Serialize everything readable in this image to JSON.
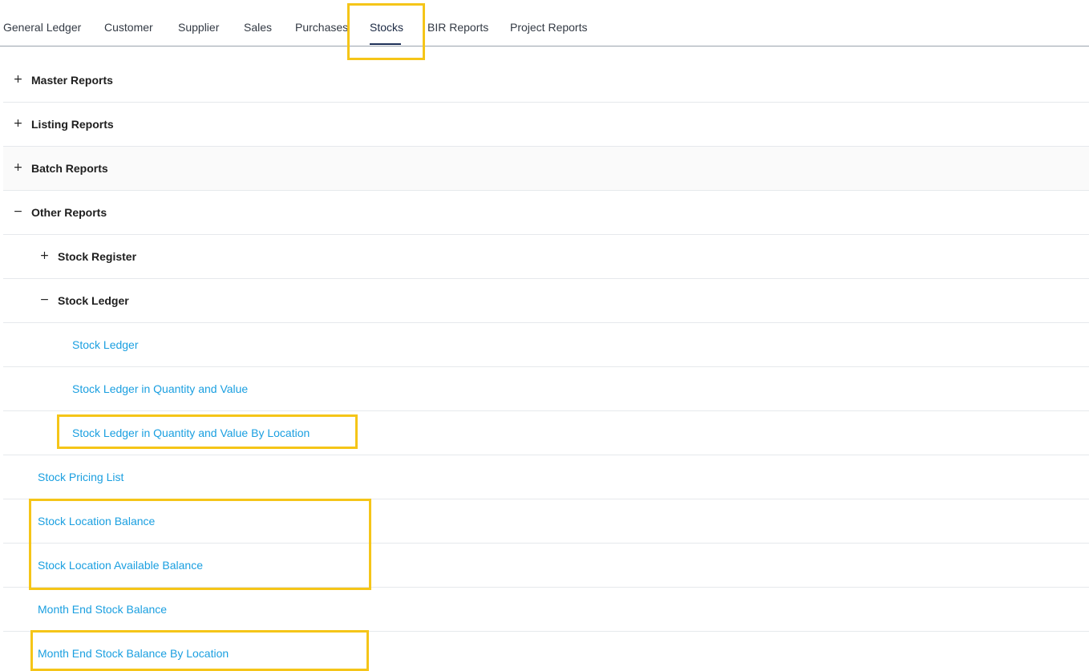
{
  "tabs": [
    {
      "label": "General Ledger"
    },
    {
      "label": "Customer"
    },
    {
      "label": "Supplier"
    },
    {
      "label": "Sales"
    },
    {
      "label": "Purchases"
    },
    {
      "label": "Stocks"
    },
    {
      "label": "BIR Reports"
    },
    {
      "label": "Project Reports"
    }
  ],
  "active_tab": "Stocks",
  "tree": {
    "master_reports": {
      "label": "Master Reports",
      "toggle": "+"
    },
    "listing_reports": {
      "label": "Listing Reports",
      "toggle": "+"
    },
    "batch_reports": {
      "label": "Batch Reports",
      "toggle": "+"
    },
    "other_reports": {
      "label": "Other Reports",
      "toggle": "−",
      "stock_register": {
        "label": "Stock Register",
        "toggle": "+"
      },
      "stock_ledger": {
        "label": "Stock Ledger",
        "toggle": "−",
        "items": [
          {
            "label": "Stock Ledger"
          },
          {
            "label": "Stock Ledger in Quantity and Value"
          },
          {
            "label": "Stock Ledger in Quantity and Value By Location"
          }
        ]
      },
      "items": [
        {
          "label": "Stock Pricing List"
        },
        {
          "label": "Stock Location Balance"
        },
        {
          "label": "Stock Location Available Balance"
        },
        {
          "label": "Month End Stock Balance"
        },
        {
          "label": "Month End Stock Balance By Location"
        }
      ]
    }
  },
  "colors": {
    "highlight": "#f5c518",
    "link": "#1a9fe0",
    "tab_underline": "#1c2f57"
  }
}
